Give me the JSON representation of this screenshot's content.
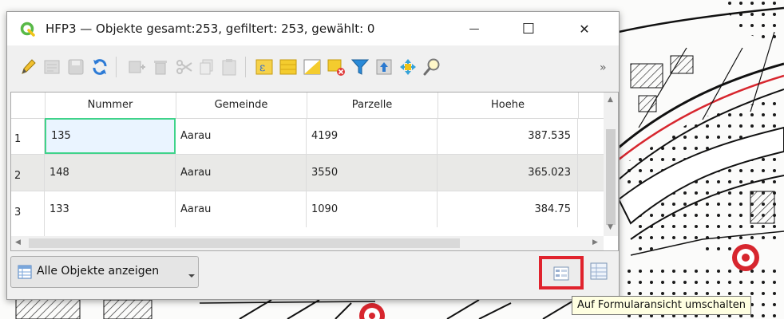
{
  "window": {
    "title": "HFP3 — Objekte gesamt:253, gefiltert: 253, gewählt: 0",
    "controls": {
      "minimize": "—",
      "maximize": "☐",
      "close": "✕"
    }
  },
  "toolbar": {
    "more_label": "»"
  },
  "table": {
    "columns": [
      "Nummer",
      "Gemeinde",
      "Parzelle",
      "Hoehe"
    ],
    "rows": [
      {
        "row_number": "1",
        "cells": [
          "135",
          "Aarau",
          "4199",
          "387.535"
        ]
      },
      {
        "row_number": "2",
        "cells": [
          "148",
          "Aarau",
          "3550",
          "365.023"
        ]
      },
      {
        "row_number": "3",
        "cells": [
          "133",
          "Aarau",
          "1090",
          "384.75"
        ]
      }
    ]
  },
  "bottom": {
    "filter_button_label": "Alle Objekte anzeigen",
    "tooltip": "Auf Formularansicht umschalten"
  },
  "colors": {
    "selection_border": "#3fd38a",
    "highlight_box": "#e0232d",
    "qgis_green": "#58b947",
    "map_red": "#d7262e"
  }
}
